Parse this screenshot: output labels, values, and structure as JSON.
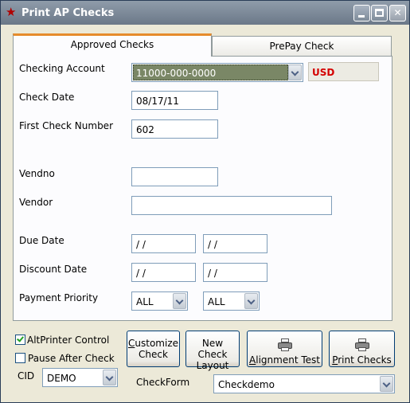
{
  "window": {
    "title": "Print AP Checks",
    "app_icon": "star-icon",
    "controls": {
      "minimize_icon": "minimize-icon",
      "maximize_icon": "maximize-icon",
      "close_icon": "close-icon",
      "close_glyph": "✕"
    }
  },
  "tabs": [
    {
      "label": "Approved Checks",
      "active": true
    },
    {
      "label": "PrePay Check",
      "active": false
    }
  ],
  "form": {
    "checking_account": {
      "label": "Checking Account",
      "value": "11000-000-0000",
      "currency": "USD"
    },
    "check_date": {
      "label": "Check Date",
      "value": "08/17/11"
    },
    "first_check_number": {
      "label": "First Check Number",
      "value": "602"
    },
    "vendno": {
      "label": "Vendno",
      "value": ""
    },
    "vendor": {
      "label": "Vendor",
      "value": ""
    },
    "due_date": {
      "label": "Due Date",
      "from": " / /",
      "to": " / /"
    },
    "discount_date": {
      "label": "Discount Date",
      "from": " / /",
      "to": " / /"
    },
    "payment_priority": {
      "label": "Payment Priority",
      "from": "ALL",
      "to": "ALL"
    }
  },
  "options": {
    "alt_printer_control": {
      "label": "AltPrinter Control",
      "checked": true
    },
    "pause_after_check": {
      "label": "Pause After Check",
      "checked": false
    },
    "cid": {
      "label": "CID",
      "value": "DEMO"
    },
    "checkform": {
      "label": "CheckForm",
      "value": "Checkdemo"
    }
  },
  "buttons": {
    "customize_check": {
      "line1": "Customize",
      "line2": "Check"
    },
    "new_check_layout": {
      "line1": "New Check",
      "line2": "Layout"
    },
    "alignment_test": {
      "label": "Alignment Test",
      "icon": "printer-icon"
    },
    "print_checks": {
      "label": "Print Checks",
      "icon": "printer-icon"
    }
  },
  "colors": {
    "titlebar": "#7d8a99",
    "tab_accent": "#e68b2c",
    "selected_account_bg": "#7a8766",
    "currency_text": "#d40000",
    "checkmark": "#21a121"
  }
}
